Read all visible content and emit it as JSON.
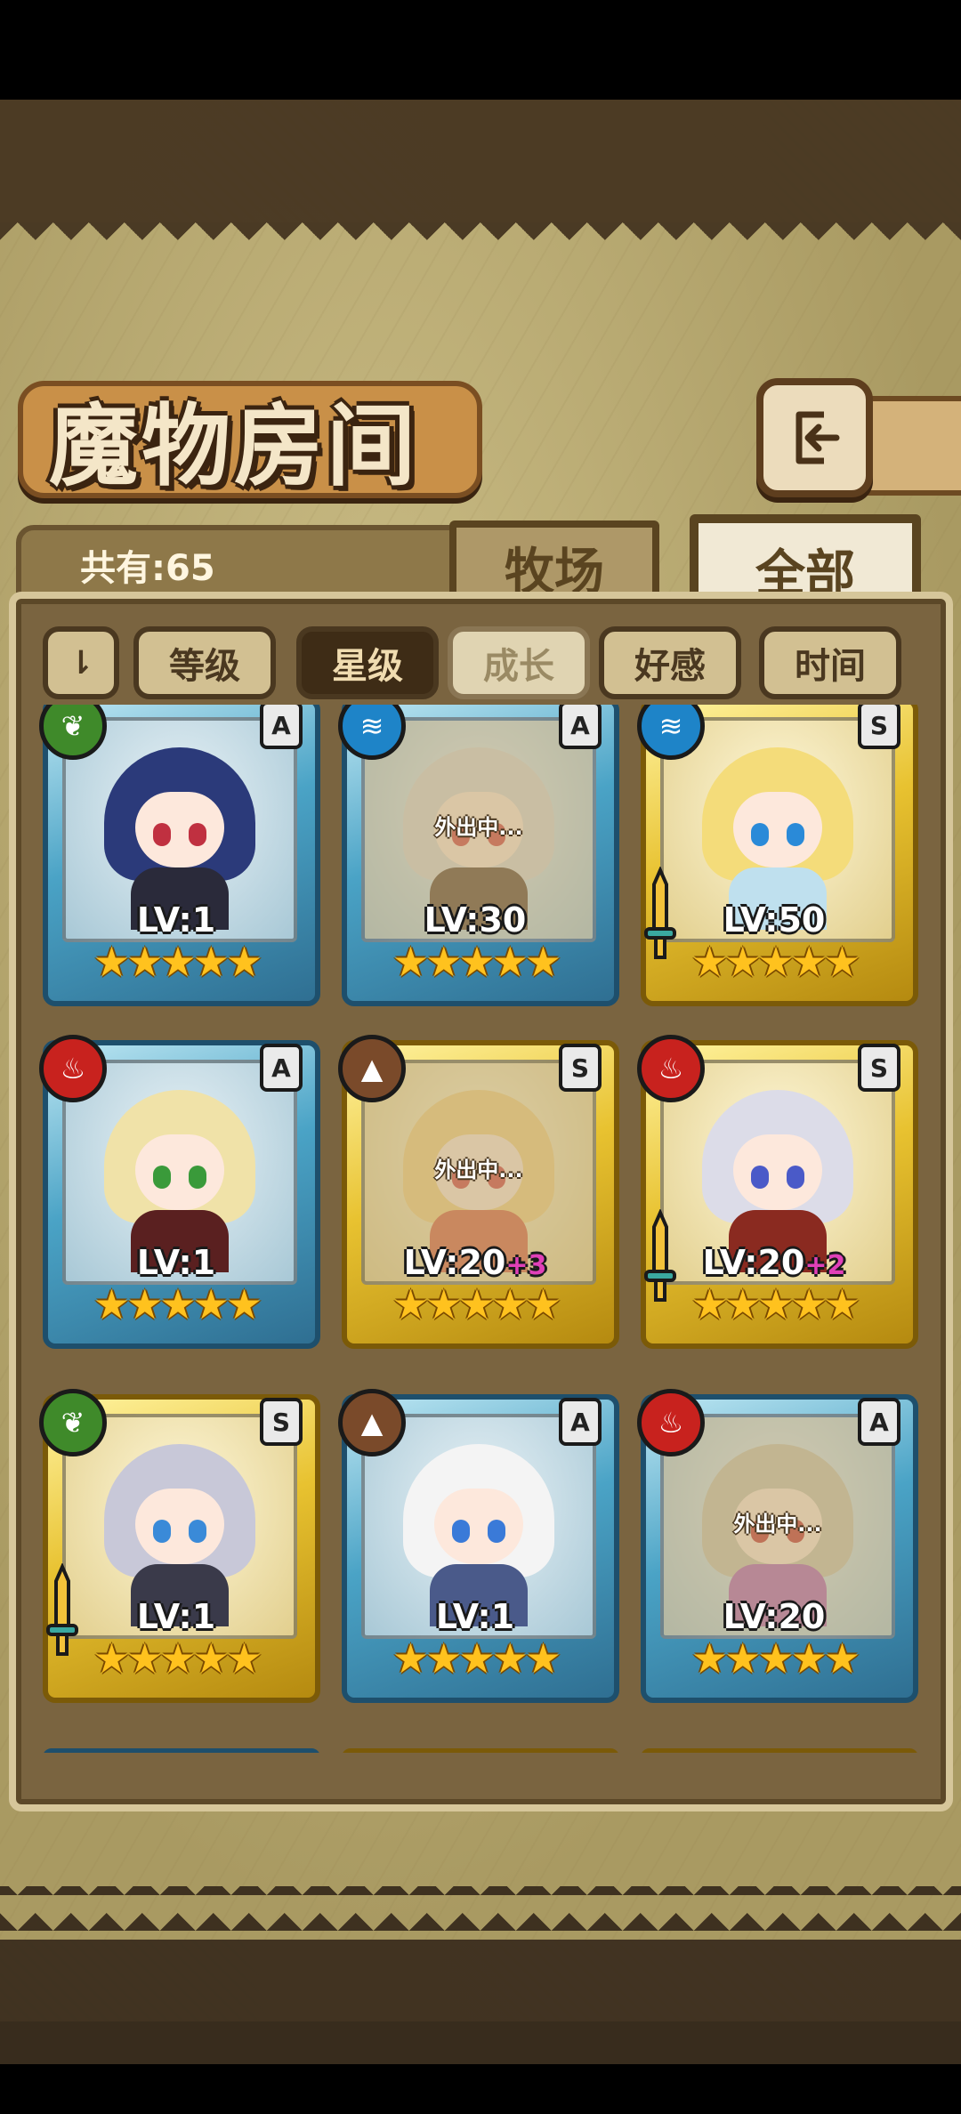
{
  "header": {
    "title": "魔物房间",
    "back_icon": "back-arrow-icon"
  },
  "count": {
    "label": "共有:65"
  },
  "tabs": [
    {
      "label": "牧场",
      "active": false
    },
    {
      "label": "全部",
      "active": true
    }
  ],
  "sort": {
    "toggle_label": "⇂",
    "buttons": [
      {
        "label": "等级",
        "state": "normal"
      },
      {
        "label": "星级",
        "state": "active"
      },
      {
        "label": "成长",
        "state": "dim"
      },
      {
        "label": "好感",
        "state": "normal"
      },
      {
        "label": "时间",
        "state": "normal"
      }
    ]
  },
  "monsters": [
    {
      "lv": "LV:1",
      "plus": "",
      "rank": "A",
      "element": "nature",
      "frame": "blue",
      "away": false,
      "stars": 5,
      "sword": false,
      "hair": "#2b3a7a",
      "eye": "#c03040",
      "body": "#2a2a3a"
    },
    {
      "lv": "LV:30",
      "plus": "",
      "rank": "A",
      "element": "water",
      "frame": "blue",
      "away": true,
      "away_text": "外出中...",
      "stars": 5,
      "sword": false,
      "hair": "#d8d8d8",
      "eye": "#d04040",
      "body": "#5a4030"
    },
    {
      "lv": "LV:50",
      "plus": "",
      "rank": "S",
      "element": "water",
      "frame": "gold",
      "away": false,
      "stars": 5,
      "sword": true,
      "hair": "#f4dc7a",
      "eye": "#2a8ad8",
      "body": "#bfe0ee"
    },
    {
      "lv": "LV:1",
      "plus": "",
      "rank": "A",
      "element": "fire",
      "frame": "blue",
      "away": false,
      "stars": 5,
      "sword": false,
      "hair": "#f0e2a8",
      "eye": "#3a9a3a",
      "body": "#5a2020"
    },
    {
      "lv": "LV:20",
      "plus": "+3",
      "rank": "S",
      "element": "earth",
      "frame": "gold",
      "away": true,
      "away_text": "外出中...",
      "stars": 5,
      "sword": false,
      "hair": "#f4d080",
      "eye": "#d04040",
      "body": "#d86040"
    },
    {
      "lv": "LV:20",
      "plus": "+2",
      "rank": "S",
      "element": "fire",
      "frame": "gold",
      "away": false,
      "stars": 5,
      "sword": true,
      "hair": "#dcdce8",
      "eye": "#4a5ac8",
      "body": "#8a2a20"
    },
    {
      "lv": "LV:1",
      "plus": "",
      "rank": "S",
      "element": "nature",
      "frame": "gold",
      "away": false,
      "stars": 5,
      "sword": true,
      "hair": "#c8c8d8",
      "eye": "#3a8ad8",
      "body": "#3a3a4a"
    },
    {
      "lv": "LV:1",
      "plus": "",
      "rank": "A",
      "element": "earth",
      "frame": "blue",
      "away": false,
      "stars": 5,
      "sword": false,
      "hair": "#f4f4f4",
      "eye": "#3a7ad8",
      "body": "#4a5a8a"
    },
    {
      "lv": "LV:20",
      "plus": "",
      "rank": "A",
      "element": "fire",
      "frame": "blue",
      "away": true,
      "away_text": "外出中...",
      "stars": 5,
      "sword": false,
      "hair": "#c8c4b0",
      "eye": "#c03030",
      "body": "#b060b8"
    }
  ],
  "partial_row_frames": [
    "blue",
    "gold",
    "gold"
  ],
  "element_icons": {
    "nature": "leaf-icon",
    "water": "wave-icon",
    "fire": "flame-icon",
    "earth": "mountain-icon"
  },
  "colors": {
    "accent_active_tab": "#3e2c16",
    "star": "#ffc21e",
    "plus_level": "#e040b8"
  }
}
